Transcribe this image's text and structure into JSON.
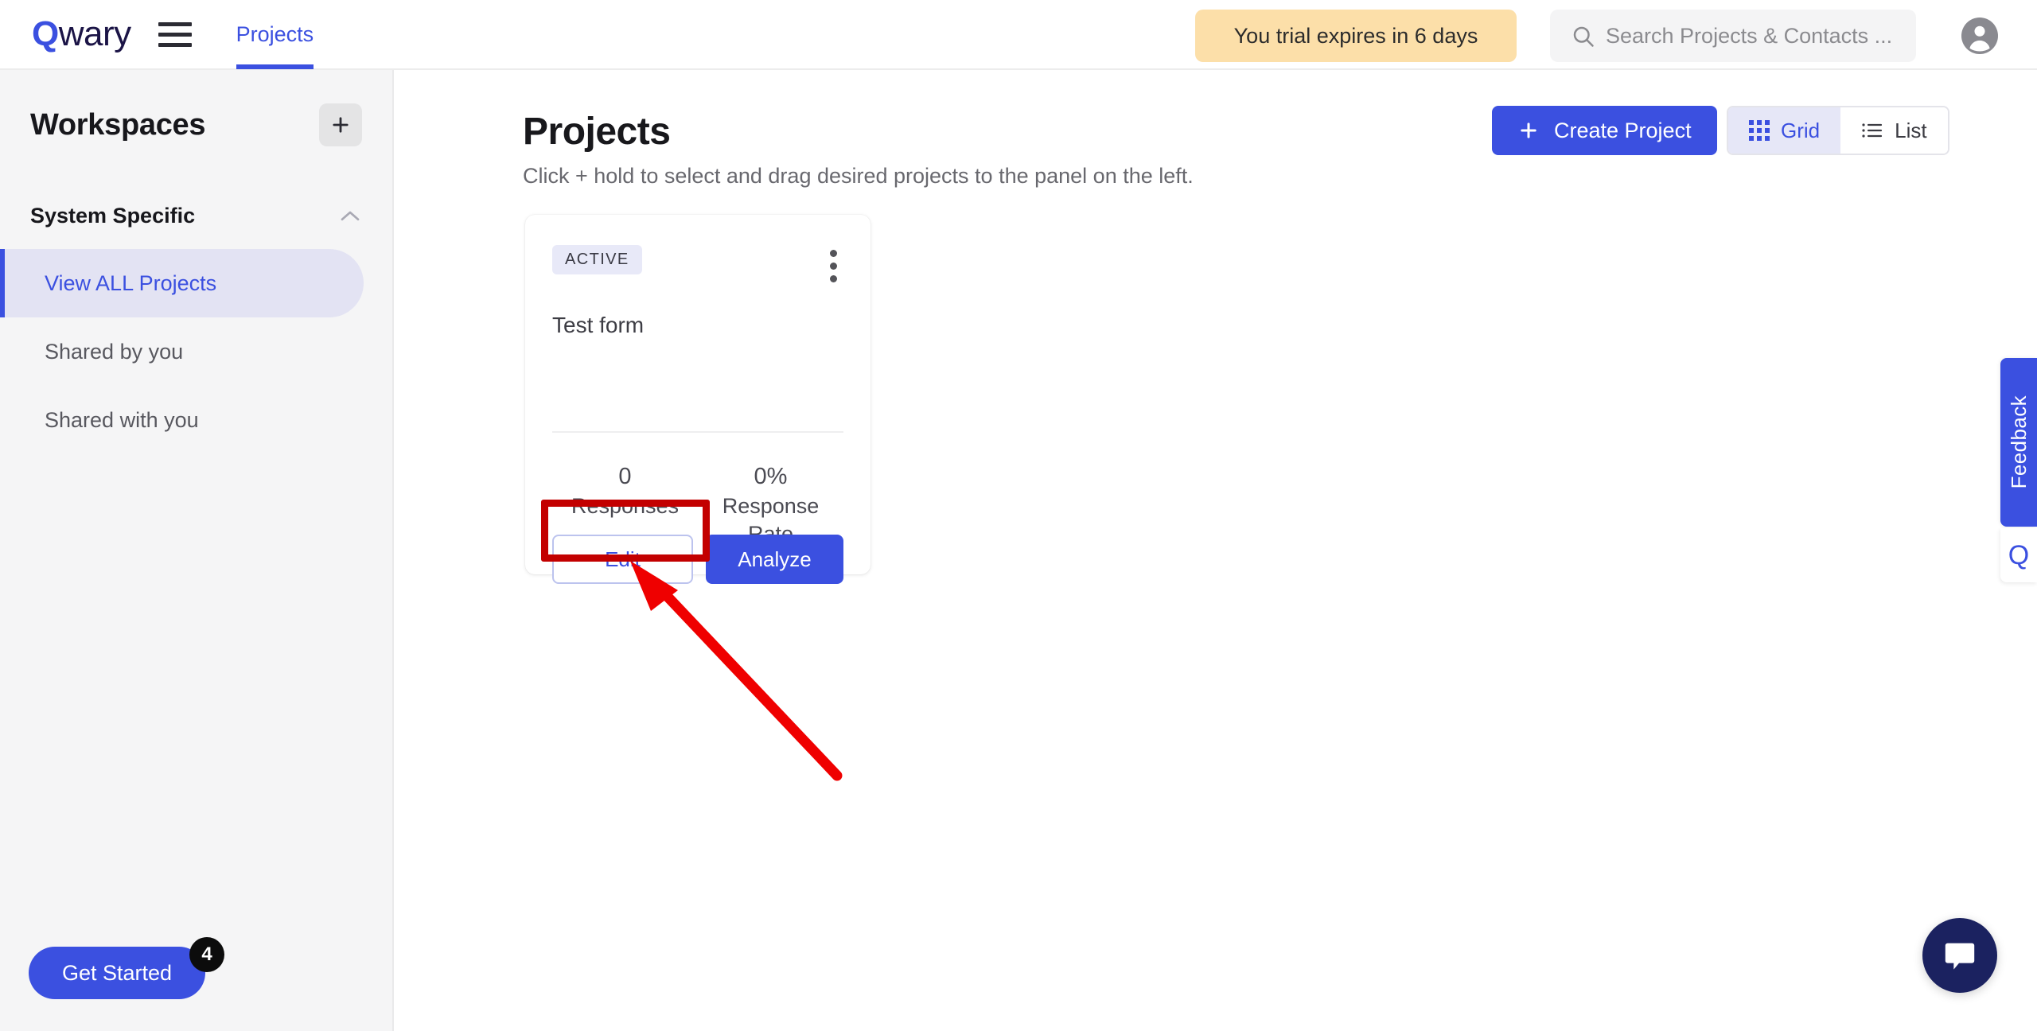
{
  "brand": {
    "logo_first": "Q",
    "logo_rest": "wary",
    "accent_color": "#3b50e0",
    "dark_color": "#1b1446"
  },
  "topbar": {
    "menu_icon": "hamburger-icon",
    "tabs": [
      {
        "label": "Projects",
        "active": true
      }
    ],
    "trial_notice": "You trial expires in 6 days",
    "trial_bg": "#fcdfa9",
    "search": {
      "icon": "search-icon",
      "placeholder": "Search Projects & Contacts ...",
      "value": ""
    },
    "avatar_icon": "user-avatar-icon"
  },
  "sidebar": {
    "title": "Workspaces",
    "add_icon": "plus-icon",
    "group": {
      "label": "System Specific",
      "chevron_icon": "chevron-up-icon",
      "expanded": true
    },
    "items": [
      {
        "label": "View ALL Projects",
        "active": true
      },
      {
        "label": "Shared by you",
        "active": false
      },
      {
        "label": "Shared with you",
        "active": false
      }
    ],
    "get_started": {
      "label": "Get Started",
      "badge_count": "4"
    }
  },
  "main": {
    "title": "Projects",
    "subtitle": "Click + hold to select and drag desired projects to the panel on the left.",
    "create_button": {
      "label": "Create Project",
      "icon": "plus-icon"
    },
    "view_toggle": {
      "options": [
        {
          "label": "Grid",
          "icon": "grid-icon",
          "active": true
        },
        {
          "label": "List",
          "icon": "list-icon",
          "active": false
        }
      ]
    },
    "projects": [
      {
        "status": "ACTIVE",
        "name": "Test form",
        "menu_icon": "kebab-menu-icon",
        "stats": [
          {
            "value": "0",
            "label": "Responses"
          },
          {
            "value": "0%",
            "label": "Response Rate"
          }
        ],
        "edit_label": "Edit",
        "analyze_label": "Analyze"
      }
    ]
  },
  "widgets": {
    "feedback_label": "Feedback",
    "feedback_logo": "Q",
    "chat_icon": "chat-bubble-icon"
  },
  "annotation": {
    "highlight_color": "#c30000",
    "highlight_target": "Edit",
    "arrow_icon": "arrow-pointer"
  }
}
